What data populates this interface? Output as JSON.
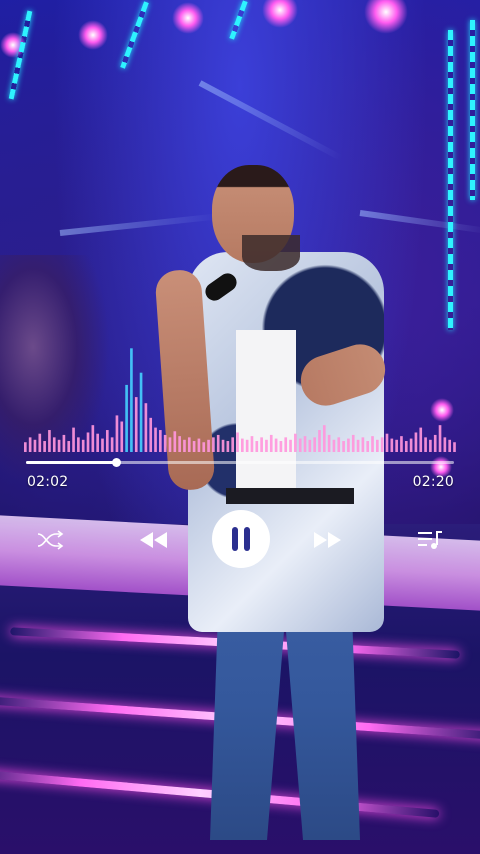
{
  "player": {
    "elapsed": "02:02",
    "total": "02:20",
    "progress_fraction": 0.21,
    "state": "playing"
  },
  "controls": {
    "shuffle_icon": "shuffle-icon",
    "previous_icon": "rewind-icon",
    "play_pause_icon": "pause-icon",
    "next_icon": "fast-forward-icon",
    "queue_icon": "playlist-icon"
  },
  "visualizer": {
    "levels": [
      0.08,
      0.12,
      0.1,
      0.15,
      0.09,
      0.18,
      0.12,
      0.1,
      0.14,
      0.09,
      0.2,
      0.12,
      0.1,
      0.16,
      0.22,
      0.15,
      0.11,
      0.18,
      0.12,
      0.3,
      0.25,
      0.55,
      0.85,
      0.45,
      0.65,
      0.4,
      0.28,
      0.2,
      0.18,
      0.14,
      0.12,
      0.17,
      0.13,
      0.1,
      0.12,
      0.09,
      0.11,
      0.08,
      0.1,
      0.12,
      0.14,
      0.1,
      0.09,
      0.12,
      0.16,
      0.11,
      0.1,
      0.13,
      0.09,
      0.12,
      0.1,
      0.14,
      0.11,
      0.09,
      0.12,
      0.1,
      0.15,
      0.11,
      0.13,
      0.1,
      0.12,
      0.18,
      0.22,
      0.14,
      0.1,
      0.12,
      0.09,
      0.11,
      0.14,
      0.1,
      0.12,
      0.09,
      0.13,
      0.1,
      0.12,
      0.15,
      0.11,
      0.1,
      0.13,
      0.09,
      0.11,
      0.16,
      0.2,
      0.12,
      0.1,
      0.14,
      0.22,
      0.12,
      0.1,
      0.08
    ]
  },
  "colors": {
    "visualizer_bar": "#ff96dc",
    "accent": "#ffffff",
    "pause_glyph": "#2b2f8f"
  }
}
